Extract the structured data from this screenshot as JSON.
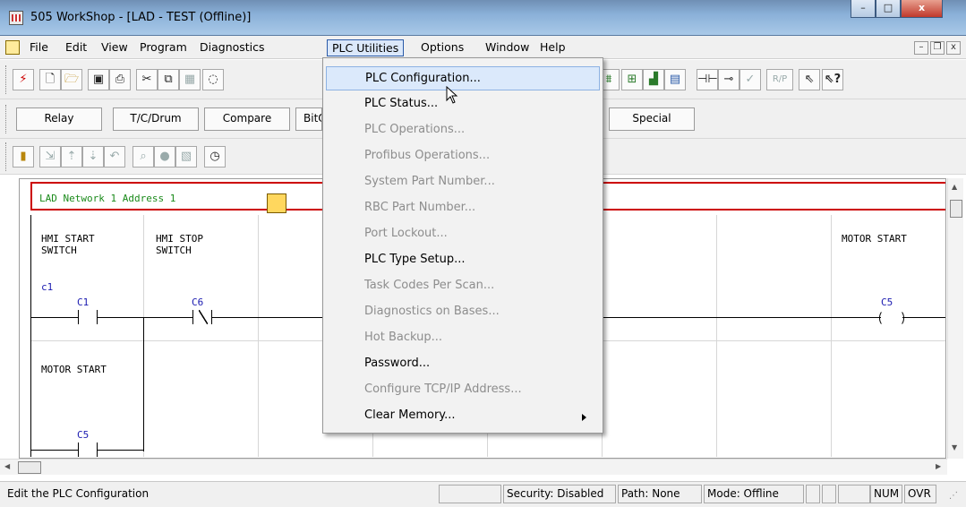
{
  "window": {
    "title": "505 WorkShop - [LAD - TEST (Offline)]",
    "controls": {
      "minimize": "–",
      "maximize": "□",
      "close": "x"
    }
  },
  "menubar": {
    "items": [
      "File",
      "Edit",
      "View",
      "Program",
      "Diagnostics",
      "PLC Utilities",
      "Options",
      "Window",
      "Help"
    ],
    "active": "PLC Utilities",
    "mdi_controls": {
      "minimize": "–",
      "restore": "❐",
      "close": "x"
    }
  },
  "toolbar_categories": {
    "buttons": [
      "Relay",
      "T/C/Drum",
      "Compare",
      "BitO",
      "Special"
    ]
  },
  "toolbar_right": {
    "rp_label": "R/P"
  },
  "ladder": {
    "network_label": "LAD Network 1 Address  1",
    "rung1": {
      "elem1_desc": "HMI START\nSWITCH",
      "elem1_note": "c1",
      "elem1_addr": "C1",
      "elem2_desc": "HMI STOP\nSWITCH",
      "elem2_addr": "C6",
      "coil_desc": "MOTOR START",
      "coil_addr": "C5"
    },
    "rung2": {
      "elem1_desc": "MOTOR START",
      "elem1_addr": "C5"
    }
  },
  "dropdown": {
    "items": [
      {
        "label": "PLC Configuration...",
        "enabled": true,
        "hover": true
      },
      {
        "label": "PLC Status...",
        "enabled": true
      },
      {
        "label": "PLC Operations...",
        "enabled": false
      },
      {
        "label": "Profibus Operations...",
        "enabled": false
      },
      {
        "label": "System Part Number...",
        "enabled": false
      },
      {
        "label": "RBC Part Number...",
        "enabled": false
      },
      {
        "label": "Port Lockout...",
        "enabled": false
      },
      {
        "label": "PLC Type Setup...",
        "enabled": true
      },
      {
        "label": "Task Codes Per Scan...",
        "enabled": false
      },
      {
        "label": "Diagnostics on Bases...",
        "enabled": false
      },
      {
        "label": "Hot Backup...",
        "enabled": false
      },
      {
        "label": "Password...",
        "enabled": true
      },
      {
        "label": "Configure TCP/IP Address...",
        "enabled": false
      },
      {
        "label": "Clear Memory...",
        "enabled": true,
        "submenu": true
      }
    ]
  },
  "statusbar": {
    "message": "Edit the PLC Configuration",
    "security": "Security: Disabled",
    "path": "Path: None",
    "mode": "Mode: Offline",
    "num": "NUM",
    "ovr": "OVR"
  }
}
